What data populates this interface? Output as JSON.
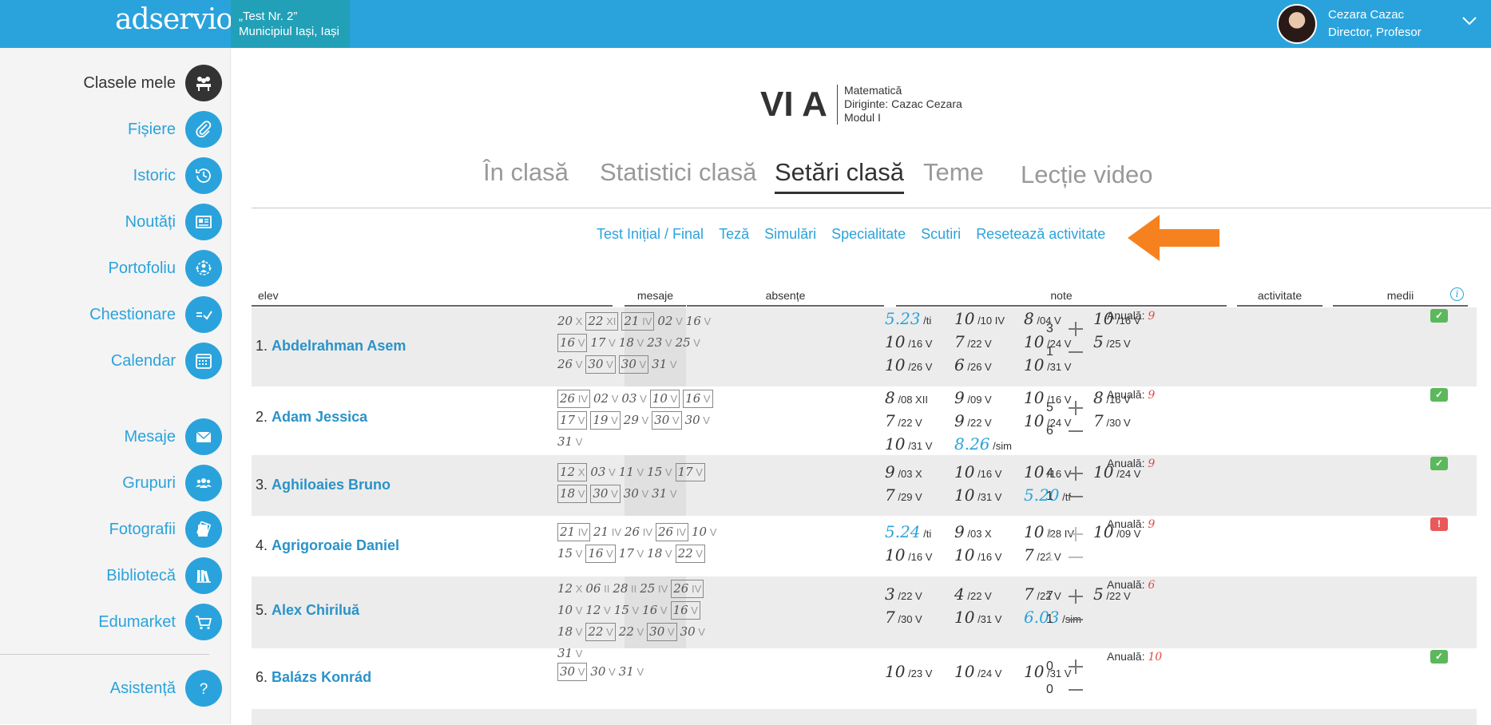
{
  "topbar": {
    "logo": "adservio",
    "school_line1": "„Test Nr. 2”",
    "school_line2": "Municipiul Iași, Iași",
    "user_name": "Cezara Cazac",
    "user_role": "Director, Profesor"
  },
  "sidebar": {
    "items": [
      {
        "label": "Clasele mele",
        "icon": "class-icon"
      },
      {
        "label": "Fișiere",
        "icon": "paperclip-icon"
      },
      {
        "label": "Istoric",
        "icon": "history-icon"
      },
      {
        "label": "Noutăți",
        "icon": "news-icon"
      },
      {
        "label": "Portofoliu",
        "icon": "portfolio-icon"
      },
      {
        "label": "Chestionare",
        "icon": "survey-icon"
      },
      {
        "label": "Calendar",
        "icon": "calendar-icon"
      },
      {
        "label": "Mesaje",
        "icon": "mail-icon"
      },
      {
        "label": "Grupuri",
        "icon": "groups-icon"
      },
      {
        "label": "Fotografii",
        "icon": "photos-icon"
      },
      {
        "label": "Bibliotecă",
        "icon": "library-icon"
      },
      {
        "label": "Edumarket",
        "icon": "cart-icon"
      },
      {
        "label": "Asistență",
        "icon": "help-icon"
      }
    ]
  },
  "header": {
    "class_name": "VI A",
    "subject": "Matematică",
    "diriginte": "Diriginte: Cazac Cezara",
    "modul": "Modul I"
  },
  "tabs": [
    "În clasă",
    "Statistici clasă",
    "Setări clasă",
    "Teme",
    "Lecție video"
  ],
  "active_tab": "Setări clasă",
  "subnav": [
    "Test Inițial / Final",
    "Teză",
    "Simulări",
    "Specialitate",
    "Scutiri",
    "Resetează activitate"
  ],
  "table": {
    "headers": {
      "elev": "elev",
      "mesaje": "mesaje",
      "absente": "absențe",
      "note": "note",
      "activitate": "activitate",
      "medii": "medii"
    },
    "rows": [
      {
        "index": "1.",
        "name": "Abdelrahman Asem",
        "absences": [
          {
            "d": "20",
            "m": "X",
            "box": false
          },
          {
            "d": "22",
            "m": "XI",
            "box": true
          },
          {
            "d": "21",
            "m": "IV",
            "box": true
          },
          {
            "d": "02",
            "m": "V",
            "box": false
          },
          {
            "d": "16",
            "m": "V",
            "box": false
          },
          {
            "d": "16",
            "m": "V",
            "box": true
          },
          {
            "d": "17",
            "m": "V",
            "box": false
          },
          {
            "d": "18",
            "m": "V",
            "box": false
          },
          {
            "d": "23",
            "m": "V",
            "box": false
          },
          {
            "d": "25",
            "m": "V",
            "box": false
          },
          {
            "d": "26",
            "m": "V",
            "box": false
          },
          {
            "d": "30",
            "m": "V",
            "box": true
          },
          {
            "d": "30",
            "m": "V",
            "box": true
          },
          {
            "d": "31",
            "m": "V",
            "box": false
          }
        ],
        "notes": [
          {
            "v": "5.23",
            "d": "/ti",
            "blue": true
          },
          {
            "v": "10",
            "d": "/10 IV"
          },
          {
            "v": "8",
            "d": "/04 V"
          },
          {
            "v": "10",
            "d": "/16 V"
          },
          {
            "v": "10",
            "d": "/16 V"
          },
          {
            "v": "7",
            "d": "/22 V"
          },
          {
            "v": "10",
            "d": "/24 V"
          },
          {
            "v": "5",
            "d": "/25 V"
          },
          {
            "v": "10",
            "d": "/26 V"
          },
          {
            "v": "6",
            "d": "/26 V"
          },
          {
            "v": "10",
            "d": "/31 V"
          }
        ],
        "act_plus": "3",
        "act_minus": "1",
        "muted": false,
        "medie_label": "Anuală:",
        "medie": "9",
        "status": "ok"
      },
      {
        "index": "2.",
        "name": "Adam Jessica",
        "absences": [
          {
            "d": "26",
            "m": "IV",
            "box": true
          },
          {
            "d": "02",
            "m": "V",
            "box": false
          },
          {
            "d": "03",
            "m": "V",
            "box": false
          },
          {
            "d": "10",
            "m": "V",
            "box": true
          },
          {
            "d": "16",
            "m": "V",
            "box": true
          },
          {
            "d": "17",
            "m": "V",
            "box": true
          },
          {
            "d": "19",
            "m": "V",
            "box": true
          },
          {
            "d": "29",
            "m": "V",
            "box": false
          },
          {
            "d": "30",
            "m": "V",
            "box": true
          },
          {
            "d": "30",
            "m": "V",
            "box": false
          },
          {
            "d": "31",
            "m": "V",
            "box": false
          }
        ],
        "notes": [
          {
            "v": "8",
            "d": "/08 XII"
          },
          {
            "v": "9",
            "d": "/09 V"
          },
          {
            "v": "10",
            "d": "/16 V"
          },
          {
            "v": "8",
            "d": "/16 V"
          },
          {
            "v": "7",
            "d": "/22 V"
          },
          {
            "v": "9",
            "d": "/22 V"
          },
          {
            "v": "10",
            "d": "/24 V"
          },
          {
            "v": "7",
            "d": "/30 V"
          },
          {
            "v": "10",
            "d": "/31 V"
          },
          {
            "v": "8.26",
            "d": "/sim",
            "blue": true
          }
        ],
        "act_plus": "5",
        "act_minus": "6",
        "muted": false,
        "medie_label": "Anuală:",
        "medie": "9",
        "status": "ok"
      },
      {
        "index": "3.",
        "name": "Aghiloaies Bruno",
        "absences": [
          {
            "d": "12",
            "m": "X",
            "box": true
          },
          {
            "d": "03",
            "m": "V",
            "box": false
          },
          {
            "d": "11",
            "m": "V",
            "box": false
          },
          {
            "d": "15",
            "m": "V",
            "box": false
          },
          {
            "d": "17",
            "m": "V",
            "box": true
          },
          {
            "d": "18",
            "m": "V",
            "box": true
          },
          {
            "d": "30",
            "m": "V",
            "box": true
          },
          {
            "d": "30",
            "m": "V",
            "box": false
          },
          {
            "d": "31",
            "m": "V",
            "box": false
          }
        ],
        "notes": [
          {
            "v": "9",
            "d": "/03 X"
          },
          {
            "v": "10",
            "d": "/16 V"
          },
          {
            "v": "10",
            "d": "/16 V"
          },
          {
            "v": "10",
            "d": "/24 V"
          },
          {
            "v": "7",
            "d": "/29 V"
          },
          {
            "v": "10",
            "d": "/31 V"
          },
          {
            "v": "5.20",
            "d": "/tf",
            "blue": true
          }
        ],
        "act_plus": "4",
        "act_minus": "1",
        "muted": false,
        "medie_label": "Anuală:",
        "medie": "9",
        "status": "ok"
      },
      {
        "index": "4.",
        "name": "Agrigoroaie Daniel",
        "absences": [
          {
            "d": "21",
            "m": "IV",
            "box": true
          },
          {
            "d": "21",
            "m": "IV",
            "box": false
          },
          {
            "d": "26",
            "m": "IV",
            "box": false
          },
          {
            "d": "26",
            "m": "IV",
            "box": true
          },
          {
            "d": "10",
            "m": "V",
            "box": false
          },
          {
            "d": "15",
            "m": "V",
            "box": false
          },
          {
            "d": "16",
            "m": "V",
            "box": true
          },
          {
            "d": "17",
            "m": "V",
            "box": false
          },
          {
            "d": "18",
            "m": "V",
            "box": false
          },
          {
            "d": "22",
            "m": "V",
            "box": true
          }
        ],
        "notes": [
          {
            "v": "5.24",
            "d": "/ti",
            "blue": true
          },
          {
            "v": "9",
            "d": "/03 X"
          },
          {
            "v": "10",
            "d": "/28 IV"
          },
          {
            "v": "10",
            "d": "/09 V"
          },
          {
            "v": "10",
            "d": "/16 V"
          },
          {
            "v": "10",
            "d": "/16 V"
          },
          {
            "v": "7",
            "d": "/22 V"
          }
        ],
        "act_plus": "1",
        "act_minus": "1",
        "muted": true,
        "medie_label": "Anuală:",
        "medie": "9",
        "status": "warn"
      },
      {
        "index": "5.",
        "name": "Alex Chiriluă",
        "absences": [
          {
            "d": "12",
            "m": "X",
            "box": false
          },
          {
            "d": "06",
            "m": "II",
            "box": false
          },
          {
            "d": "28",
            "m": "II",
            "box": false
          },
          {
            "d": "25",
            "m": "IV",
            "box": false
          },
          {
            "d": "26",
            "m": "IV",
            "box": true
          },
          {
            "d": "10",
            "m": "V",
            "box": false
          },
          {
            "d": "12",
            "m": "V",
            "box": false
          },
          {
            "d": "15",
            "m": "V",
            "box": false
          },
          {
            "d": "16",
            "m": "V",
            "box": false
          },
          {
            "d": "16",
            "m": "V",
            "box": true
          },
          {
            "d": "18",
            "m": "V",
            "box": false
          },
          {
            "d": "22",
            "m": "V",
            "box": true
          },
          {
            "d": "22",
            "m": "V",
            "box": false
          },
          {
            "d": "30",
            "m": "V",
            "box": true
          },
          {
            "d": "30",
            "m": "V",
            "box": false
          },
          {
            "d": "31",
            "m": "V",
            "box": false
          }
        ],
        "notes": [
          {
            "v": "3",
            "d": "/22 V"
          },
          {
            "v": "4",
            "d": "/22 V"
          },
          {
            "v": "7",
            "d": "/22 V"
          },
          {
            "v": "5",
            "d": "/22 V"
          },
          {
            "v": "7",
            "d": "/30 V"
          },
          {
            "v": "10",
            "d": "/31 V"
          },
          {
            "v": "6.03",
            "d": "/sim",
            "blue": true
          }
        ],
        "act_plus": "7",
        "act_minus": "1",
        "muted": false,
        "medie_label": "Anuală:",
        "medie": "6",
        "status": ""
      },
      {
        "index": "6.",
        "name": "Balázs Konrád",
        "absences": [
          {
            "d": "30",
            "m": "V",
            "box": true
          },
          {
            "d": "30",
            "m": "V",
            "box": false
          },
          {
            "d": "31",
            "m": "V",
            "box": false
          }
        ],
        "notes": [
          {
            "v": "10",
            "d": "/23 V"
          },
          {
            "v": "10",
            "d": "/24 V"
          },
          {
            "v": "10",
            "d": "/31 V"
          }
        ],
        "act_plus": "0",
        "act_minus": "0",
        "muted": false,
        "medie_label": "Anuală:",
        "medie": "10",
        "status": "ok"
      }
    ]
  },
  "colors": {
    "primary": "#2aa3dc",
    "school_bg": "#22a0b8",
    "arrow": "#f5821f",
    "ok": "#5cb85c",
    "warn": "#e9595b",
    "grade_red": "#e04a4a"
  }
}
